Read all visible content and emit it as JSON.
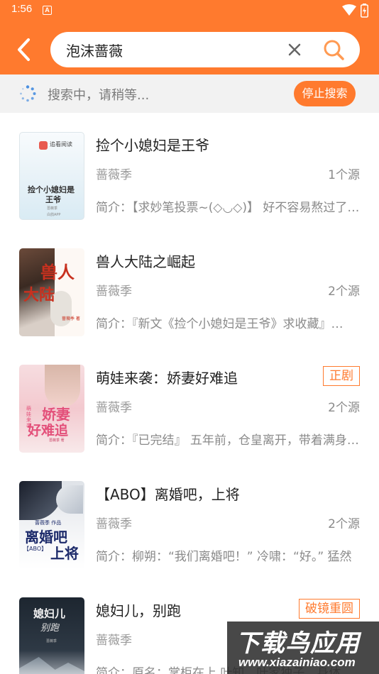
{
  "status_bar": {
    "time": "1:56",
    "notification_letter": "A"
  },
  "search": {
    "query": "泡沫蔷薇"
  },
  "progress": {
    "text": "搜索中，请稍等...",
    "stop_label": "停止搜索"
  },
  "results": [
    {
      "title": "捡个小媳妇是王爷",
      "author": "蔷薇季",
      "sources": "1个源",
      "intro": "简介：【求妙笔投票~(◇◡◇)】 好不容易熬过了艰难岁月",
      "cover": {
        "line1": "捡个小媳妇是",
        "line2": "王爷",
        "brand": "追看阅读",
        "author_small": "蔷薇季",
        "publisher_small": "白鸽APP"
      }
    },
    {
      "title": "兽人大陆之崛起",
      "author": "蔷薇季",
      "sources": "2个源",
      "intro": "简介：『新文《捡个小媳妇是王爷》求收藏』…",
      "cover": {
        "line1": "兽人",
        "line2": "大陆",
        "author_small": "蔷薇季 著"
      }
    },
    {
      "title": "萌娃来袭：娇妻好难追",
      "author": "蔷薇季",
      "sources": "2个源",
      "tag": "正剧",
      "intro": "简介：『已完结』 五年前，仓皇离开，带着满身伤痕",
      "cover": {
        "line1": "娇妻",
        "line2": "好难追",
        "small": "萌娃来袭",
        "author_small": "蔷薇季 著"
      }
    },
    {
      "title": "【ABO】离婚吧，上将",
      "author": "蔷薇季",
      "sources": "2个源",
      "intro": "简介：柳朔：“我们离婚吧！” 冷啸：“好。” 猛然",
      "cover": {
        "line1": "离婚吧",
        "line2": "上将",
        "tag": "【ABO】",
        "author_small": "蔷薇季 作品"
      }
    },
    {
      "title": "媳妇儿，别跑",
      "author": "蔷薇季",
      "sources": "",
      "tag": "破镜重圆",
      "intro": "简介：原名：掌柜在上 叶知，叶家独子，身体羸弱",
      "cover": {
        "line1": "媳妇儿",
        "line2": "别跑",
        "author_small": "蔷薇季"
      }
    }
  ],
  "watermark": {
    "title": "下载鸟应用",
    "url": "www.xiazainiao.com"
  },
  "colors": {
    "accent": "#ff7a2e",
    "status_bg": "#f2f2f2"
  }
}
